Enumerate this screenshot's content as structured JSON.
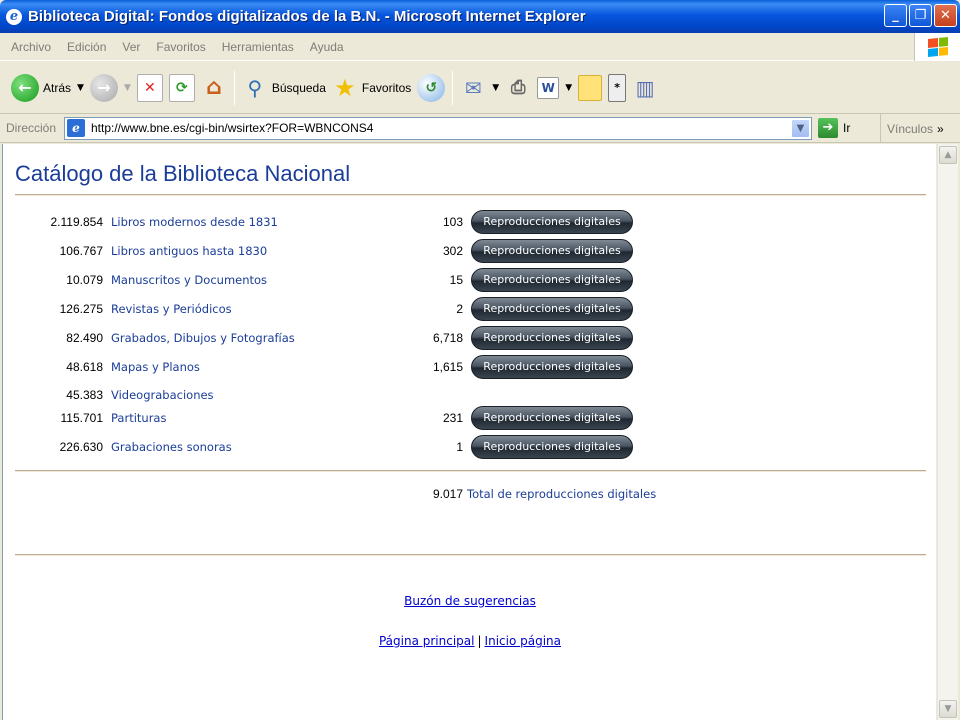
{
  "window": {
    "title": "Biblioteca Digital: Fondos digitalizados de la B.N. - Microsoft Internet Explorer",
    "minimize": "_",
    "restore": "❐",
    "close": "✕"
  },
  "menu": [
    "Archivo",
    "Edición",
    "Ver",
    "Favoritos",
    "Herramientas",
    "Ayuda"
  ],
  "toolbar": {
    "back_label": "Atrás",
    "search_label": "Búsqueda",
    "favorites_label": "Favoritos"
  },
  "address": {
    "label": "Dirección",
    "url": "http://www.bne.es/cgi-bin/wsirtex?FOR=WBNCONS4",
    "go_label": "Ir",
    "links_label": "Vínculos"
  },
  "page": {
    "title": "Catálogo de la Biblioteca Nacional",
    "button_label": "Reproducciones digitales",
    "rows": [
      {
        "count": "2.119.854",
        "name": "Libros modernos desde 1831",
        "digital": "103",
        "has_button": true
      },
      {
        "count": "106.767",
        "name": "Libros antiguos hasta 1830",
        "digital": "302",
        "has_button": true
      },
      {
        "count": "10.079",
        "name": "Manuscritos y Documentos",
        "digital": "15",
        "has_button": true
      },
      {
        "count": "126.275",
        "name": "Revistas y Periódicos",
        "digital": "2",
        "has_button": true
      },
      {
        "count": "82.490",
        "name": "Grabados, Dibujos y Fotografías",
        "digital": "6,718",
        "has_button": true
      },
      {
        "count": "48.618",
        "name": "Mapas y Planos",
        "digital": "1,615",
        "has_button": true
      },
      {
        "count": "45.383",
        "name": "Videograbaciones",
        "digital": "",
        "has_button": false
      },
      {
        "count": "115.701",
        "name": "Partituras",
        "digital": "231",
        "has_button": true
      },
      {
        "count": "226.630",
        "name": "Grabaciones sonoras",
        "digital": "1",
        "has_button": true
      }
    ],
    "total_count": "9.017",
    "total_label": "Total de reproducciones digitales",
    "suggestions_link": "Buzón de sugerencias",
    "home_link": "Página principal",
    "separator": "|",
    "top_link": "Inicio página"
  }
}
